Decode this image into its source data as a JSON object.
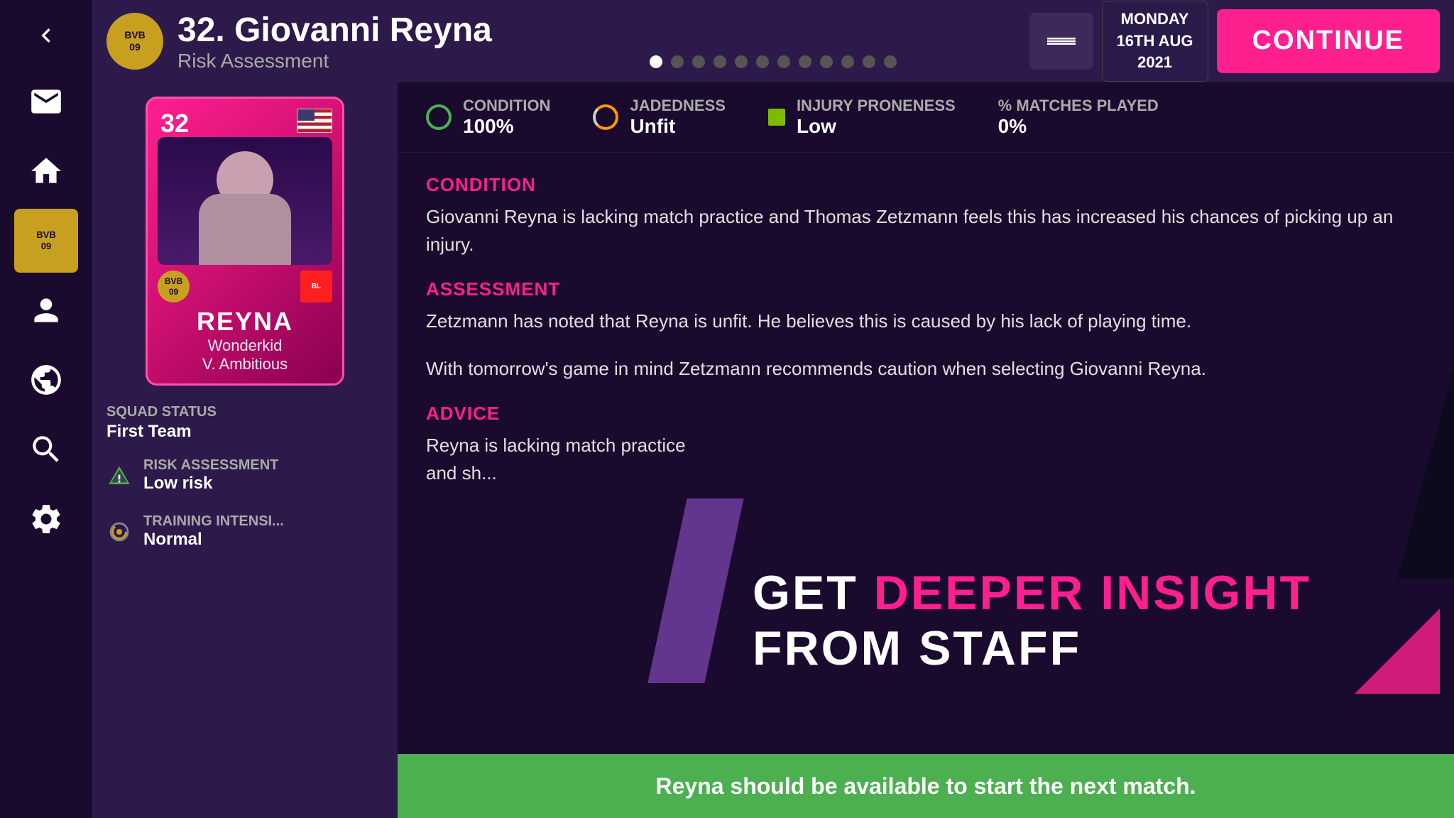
{
  "topbar": {
    "player_number": "32",
    "player_name": "32. Giovanni Reyna",
    "subtitle": "Risk Assessment",
    "date_line1": "MONDAY",
    "date_line2": "16TH AUG",
    "date_line3": "2021",
    "continue_label": "CONTINUE",
    "dots_count": 12,
    "active_dot": 0
  },
  "club": {
    "badge_text": "BVB\n09"
  },
  "player_card": {
    "number": "32",
    "name": "REYNA",
    "trait1": "Wonderkid",
    "trait2": "V. Ambitious",
    "bvb_label": "BVB\n09",
    "bundesliga_label": "BL"
  },
  "sidebar_stats": {
    "squad_status_label": "SQUAD STATUS",
    "squad_status_value": "First Team",
    "risk_assessment_label": "RISK ASSESSMENT",
    "risk_assessment_value": "Low risk",
    "training_label": "TRAINING INTENSI...",
    "training_value": "Normal"
  },
  "top_stats": {
    "condition_label": "CONDITION",
    "condition_value": "100%",
    "jadedness_label": "JADEDNESS",
    "jadedness_value": "Unfit",
    "injury_label": "INJURY PRONENESS",
    "injury_value": "Low",
    "matches_label": "% MATCHES PLAYED",
    "matches_value": "0%"
  },
  "sections": {
    "condition_title": "CONDITION",
    "condition_body": "Giovanni Reyna is lacking match practice and Thomas Zetzmann feels this has increased his chances of picking up an injury.",
    "assessment_title": "ASSESSMENT",
    "assessment_body1": "Zetzmann has noted that Reyna is unfit. He believes this is caused by his lack of playing time.",
    "assessment_body2": "With tomorrow's game in mind Zetzmann recommends caution when selecting Giovanni Reyna.",
    "advice_title": "ADVICE",
    "advice_body": "Reyna is lacking match practice and sh...",
    "promo_line1_a": "GET ",
    "promo_line1_b": "DEEPER INSIGHT",
    "promo_line2": "FROM STAFF"
  },
  "bottom_bar": {
    "text": "Reyna should be available to start the next match."
  },
  "sidebar_nav": {
    "back_label": "back",
    "mail_label": "mail",
    "home_label": "home",
    "club_label": "club",
    "staff_label": "staff",
    "globe_label": "globe",
    "search_label": "search",
    "settings_label": "settings"
  }
}
